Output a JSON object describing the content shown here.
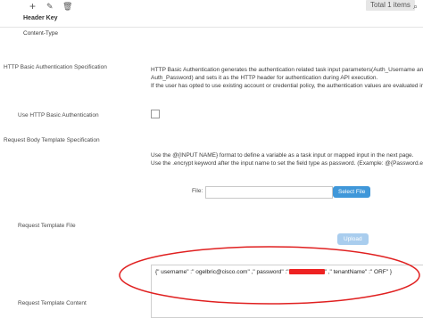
{
  "toolbar": {
    "add_icon": "plus-icon",
    "edit_icon": "pencil-icon",
    "delete_icon": "trash-icon",
    "total_label": "Total 1 items",
    "search_icon": "search-icon"
  },
  "table": {
    "header": "Header Key",
    "row_value": "Content-Type"
  },
  "basic_auth": {
    "section_label": "HTTP Basic Authentication Specification",
    "description_line1": "HTTP Basic Authentication generates the authentication related task input parameters(Auth_Username and",
    "description_line2": "Auth_Password) and sets it as the HTTP header for authentication during API execution.",
    "description_line3": "If the user has opted to use existing account or credential policy, the authentication values are evaluated inter",
    "use_label": "Use HTTP Basic Authentication",
    "checked": false
  },
  "body_template": {
    "section_label": "Request Body Template Specification",
    "help_line1": "Use the @{INPUT NAME} format to define a variable as a task input or mapped input in the next page.",
    "help_line2": "Use the .encrypt keyword after the input name to set the field type as password. (Example: @{Password.encry"
  },
  "template_file": {
    "label": "Request Template File",
    "file_label": "File:",
    "file_value": "",
    "select_button": "Select File",
    "upload_button": "Upload"
  },
  "template_content": {
    "label": "Request Template Content",
    "text_part1": "{\" username\" :\" ogelbric@cisco.com\" ,\" password\" :\"",
    "text_part2": "\" ,\" tenantName\" :\" ORF\" }"
  },
  "colors": {
    "accent": "#3f97d9",
    "annotation": "#e02020"
  }
}
